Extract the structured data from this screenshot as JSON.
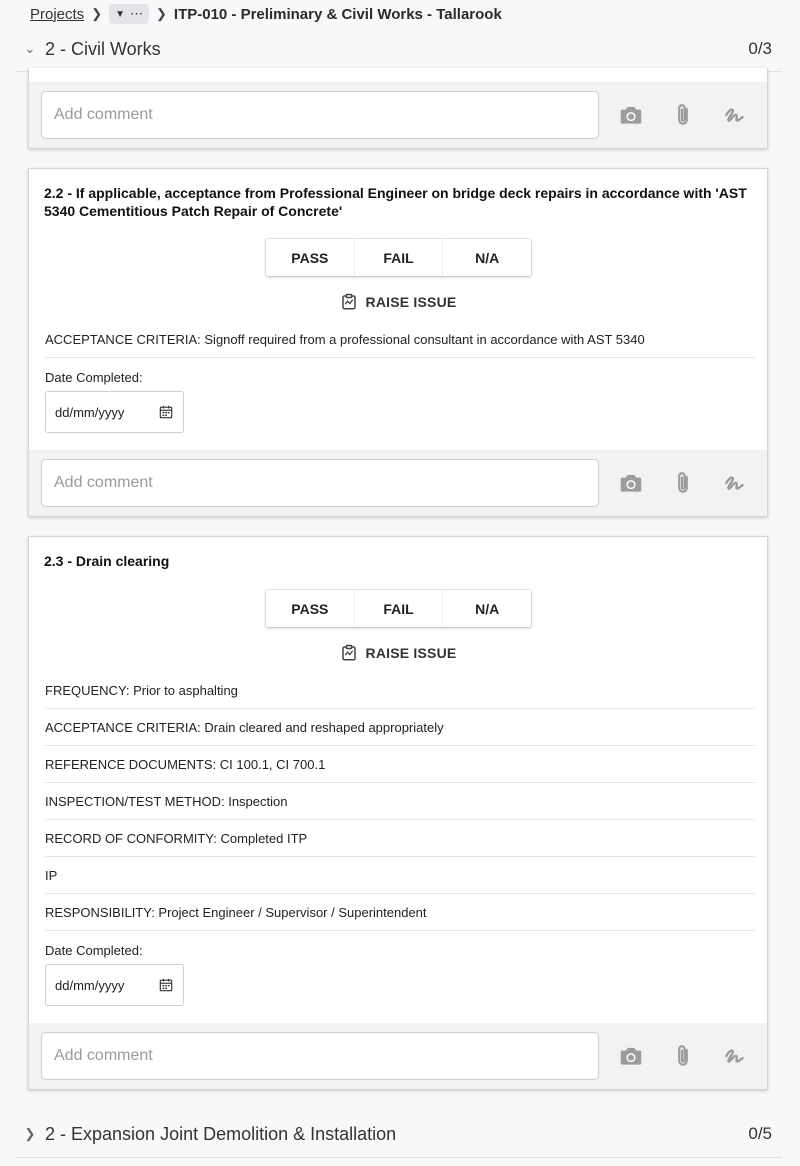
{
  "breadcrumb": {
    "projects": "Projects",
    "more": "⋯",
    "current": "ITP-010 - Preliminary & Civil Works - Tallarook"
  },
  "section_civil": {
    "title": "2 - Civil Works",
    "count": "0/3"
  },
  "section_expansion": {
    "title": "2 - Expansion Joint Demolition & Installation",
    "count": "0/5"
  },
  "comment_placeholder": "Add comment",
  "buttons": {
    "pass": "PASS",
    "fail": "FAIL",
    "na": "N/A",
    "raise_issue": "RAISE ISSUE"
  },
  "date_label": "Date Completed:",
  "date_placeholder": "dd/mm/yyyy",
  "items": [
    {
      "title": "2.2 - If applicable, acceptance from Professional Engineer on bridge deck repairs in accordance with 'AST 5340 Cementitious Patch Repair of Concrete'",
      "fields": [
        "ACCEPTANCE CRITERIA: Signoff required from a professional consultant in accordance with AST 5340"
      ]
    },
    {
      "title": "2.3 - Drain clearing",
      "fields": [
        "FREQUENCY: Prior to asphalting",
        "ACCEPTANCE CRITERIA: Drain cleared and reshaped appropriately",
        "REFERENCE DOCUMENTS: CI 100.1, CI 700.1",
        "INSPECTION/TEST METHOD: Inspection",
        "RECORD OF CONFORMITY: Completed ITP",
        "IP",
        "RESPONSIBILITY: Project Engineer / Supervisor / Superintendent"
      ]
    }
  ],
  "colors": {
    "icon_grey": "#9c9c9c",
    "footer_bg": "#f2f2f2"
  },
  "icons": [
    "camera-icon",
    "paperclip-icon",
    "signature-icon",
    "raise-issue-icon",
    "calendar-icon",
    "chevron-down-icon",
    "chevron-right-icon"
  ]
}
